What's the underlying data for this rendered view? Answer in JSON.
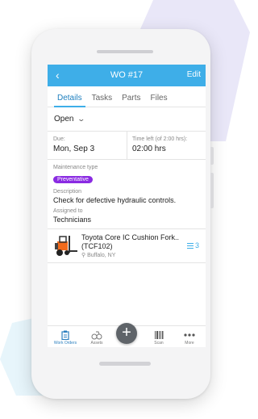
{
  "topbar": {
    "back_icon": "chevron-left-icon",
    "title": "WO #17",
    "edit_label": "Edit"
  },
  "tabs": [
    {
      "label": "Details",
      "active": true
    },
    {
      "label": "Tasks"
    },
    {
      "label": "Parts"
    },
    {
      "label": "Files"
    }
  ],
  "status": {
    "value": "Open",
    "icon": "chevron-down-icon"
  },
  "dates": {
    "due_label": "Due:",
    "due_value": "Mon, Sep 3",
    "time_label": "Time left (of 2:00 hrs):",
    "time_value": "02:00 hrs"
  },
  "details": {
    "type_label": "Maintenance type",
    "type_badge": "Preventative",
    "description_label": "Description",
    "description_value": "Check for defective hydraulic controls.",
    "assigned_label": "Assigned to",
    "assigned_value": "Technicians"
  },
  "asset": {
    "name_line1": "Toyota Core IC Cushion Fork..",
    "name_line2": "(TCF102)",
    "location": "Buffalo, NY",
    "location_icon": "pin-icon",
    "count": "3",
    "count_icon": "list-icon"
  },
  "bottom_nav": [
    {
      "label": "Work Orders",
      "icon": "clipboard-icon",
      "active": true
    },
    {
      "label": "Assets",
      "icon": "assets-icon"
    },
    {
      "label": "",
      "icon": "plus-icon"
    },
    {
      "label": "Scan",
      "icon": "barcode-icon"
    },
    {
      "label": "More",
      "icon": "more-dots-icon"
    }
  ],
  "colors": {
    "header": "#3eaee8",
    "badge": "#8a2be2",
    "accent": "#2b7fbf",
    "forklift": "#f26a1b"
  }
}
